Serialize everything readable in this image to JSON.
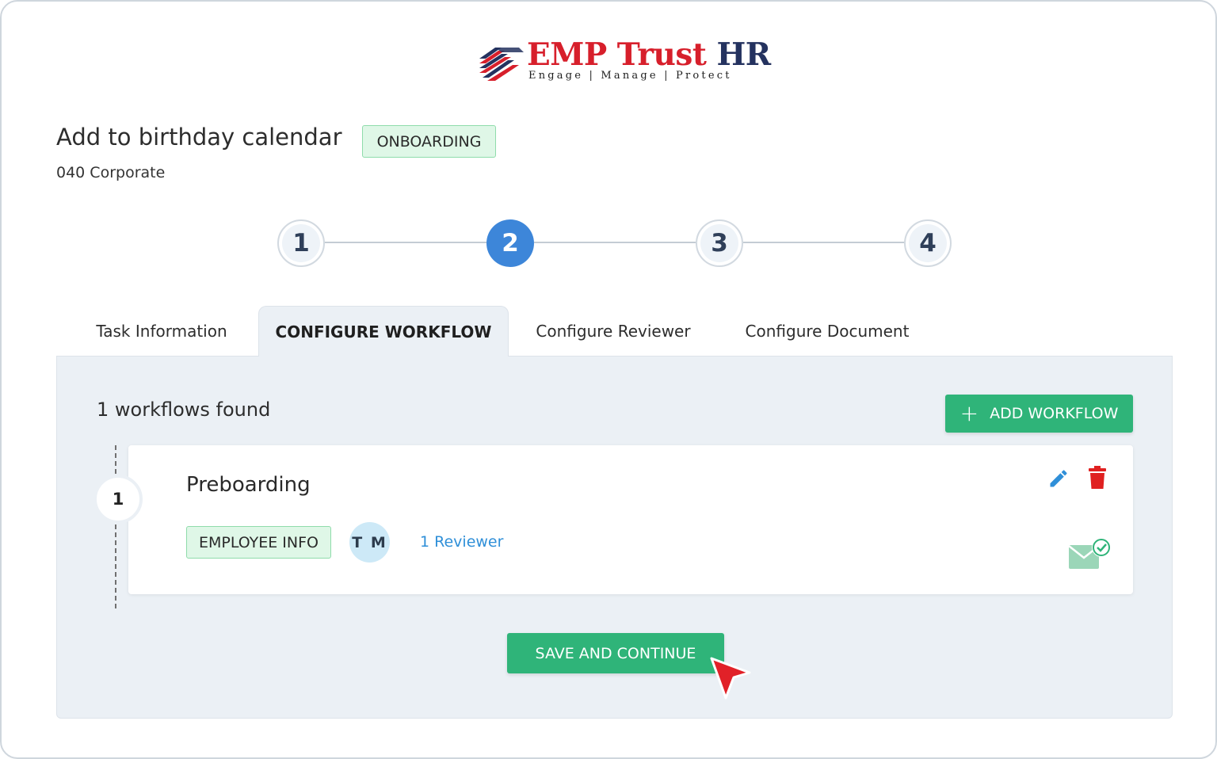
{
  "logo": {
    "brand_part1": "EMP Trust",
    "brand_part2": "HR",
    "tagline": "Engage | Manage | Protect",
    "colors": {
      "red": "#d71f2b",
      "navy": "#24325f"
    }
  },
  "header": {
    "title": "Add to birthday calendar",
    "badge": "ONBOARDING",
    "subtitle": "040 Corporate"
  },
  "stepper": {
    "steps": [
      "1",
      "2",
      "3",
      "4"
    ],
    "active_step": 2,
    "colors": {
      "active": "#3d86d9",
      "inactive": "#eef3f8"
    }
  },
  "tabs": [
    {
      "label": "Task Information",
      "active": false
    },
    {
      "label": "CONFIGURE WORKFLOW",
      "active": true
    },
    {
      "label": "Configure Reviewer",
      "active": false
    },
    {
      "label": "Configure Document",
      "active": false
    }
  ],
  "workflows": {
    "count_text": "1 workflows found",
    "add_button": {
      "label": "ADD WORKFLOW",
      "icon": "plus-icon"
    },
    "items": [
      {
        "index": "1",
        "title": "Preboarding",
        "badge": "EMPLOYEE INFO",
        "avatar_initials": "T M",
        "reviewer_link": "1 Reviewer",
        "icons": [
          "edit-icon",
          "delete-icon",
          "mail-check-icon"
        ]
      }
    ]
  },
  "footer": {
    "save_button": "SAVE AND CONTINUE"
  },
  "colors": {
    "primary_green": "#2fb479",
    "badge_green_bg": "#dff7e7",
    "link_blue": "#2f8fd8",
    "delete_red": "#e02020",
    "edit_blue": "#2f8fd8",
    "panel_bg": "#ebf0f5",
    "cursor_red": "#e12128"
  }
}
